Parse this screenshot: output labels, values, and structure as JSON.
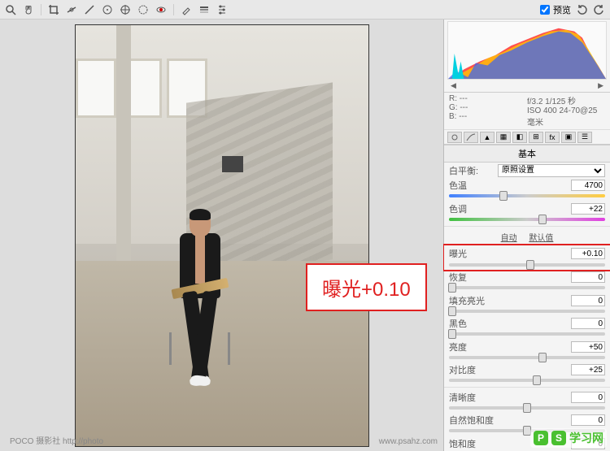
{
  "toolbar": {
    "preview_label": "预览"
  },
  "annotation": {
    "text": "曝光+0.10"
  },
  "watermark": {
    "left": "POCO 摄影社\nhttp://photo",
    "right": "www.psahz.com"
  },
  "info_bar": {
    "r": "R: ---",
    "g": "G: ---",
    "b": "B: ---",
    "aperture": "f/3.2",
    "shutter": "1/125 秒",
    "iso": "ISO 400",
    "lens": "24-70@25 毫米"
  },
  "panel": {
    "section_title": "基本",
    "white_balance_label": "白平衡:",
    "white_balance_value": "原照设置",
    "temp_label": "色温",
    "temp_value": "4700",
    "tint_label": "色调",
    "tint_value": "+22",
    "auto_label": "自动",
    "default_label": "默认值",
    "exposure_label": "曝光",
    "exposure_value": "+0.10",
    "recovery_label": "恢复",
    "recovery_value": "0",
    "fill_light_label": "填充亮光",
    "fill_light_value": "0",
    "black_label": "黑色",
    "black_value": "0",
    "brightness_label": "亮度",
    "brightness_value": "+50",
    "contrast_label": "对比度",
    "contrast_value": "+25",
    "clarity_label": "清晰度",
    "clarity_value": "0",
    "vibrance_label": "自然饱和度",
    "vibrance_value": "0",
    "saturation_label": "饱和度",
    "saturation_value": "0"
  },
  "logo": {
    "p": "P",
    "s": "S",
    "txt": "学习网"
  }
}
